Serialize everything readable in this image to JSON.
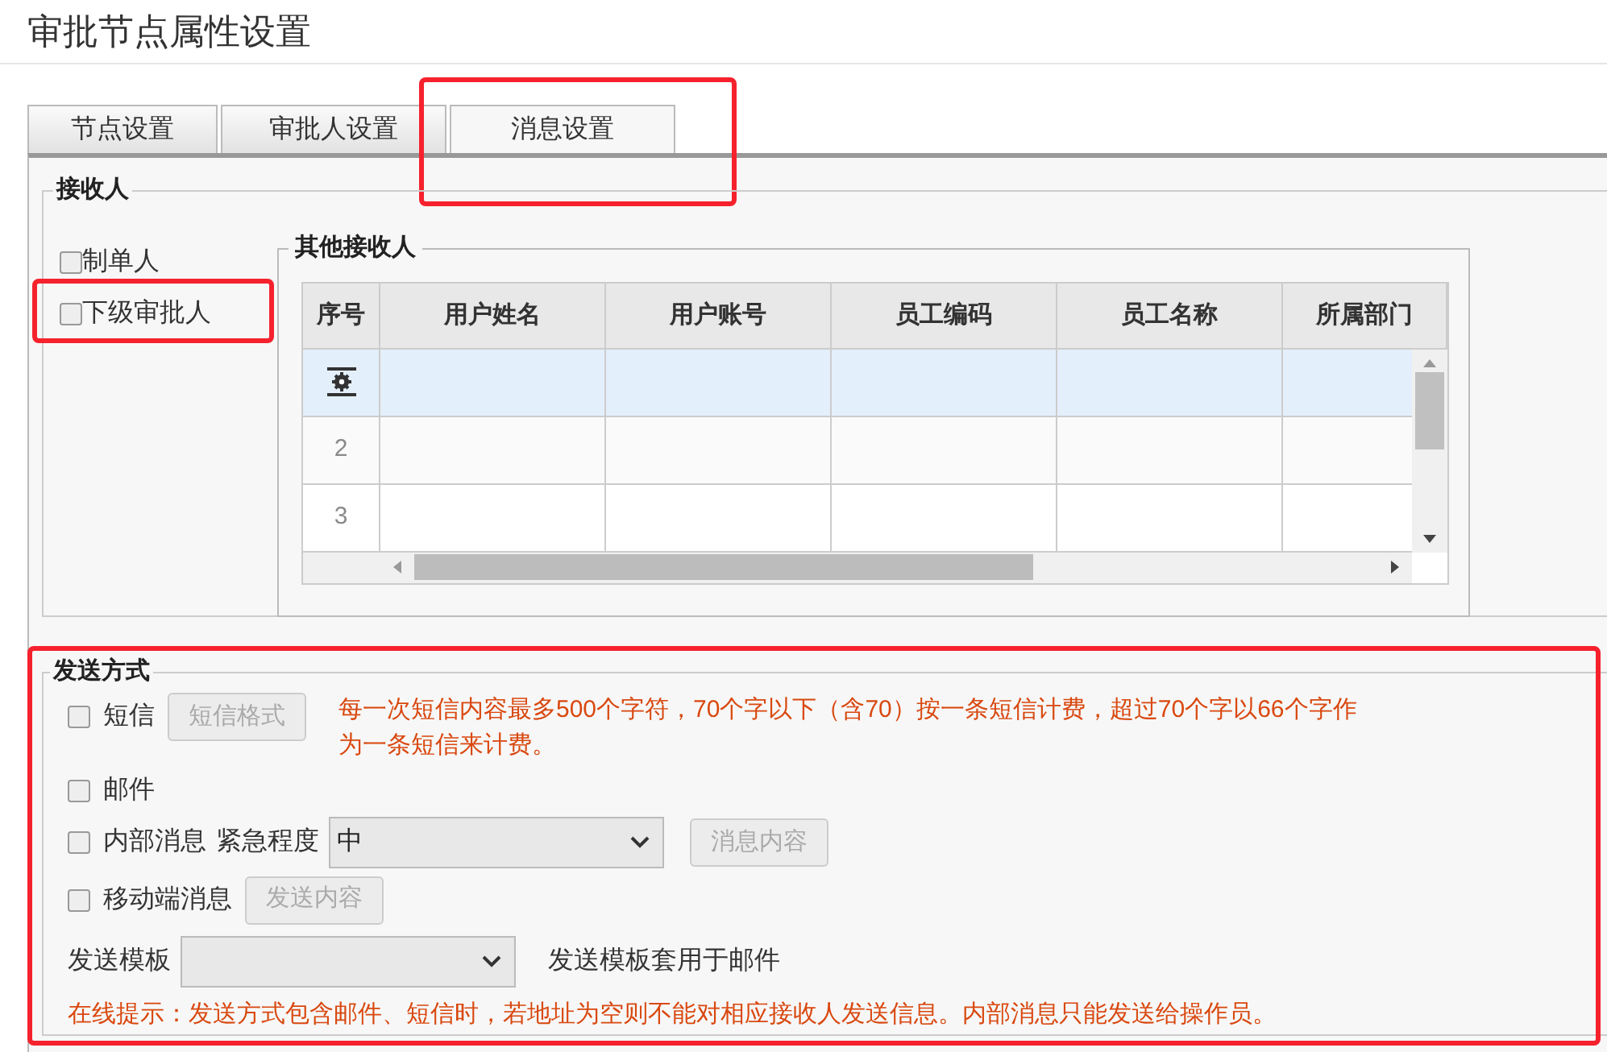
{
  "title": "审批节点属性设置",
  "tabs": [
    {
      "label": "节点设置",
      "selected": false,
      "highlighted": false
    },
    {
      "label": "审批人设置",
      "selected": false,
      "highlighted": false
    },
    {
      "label": "消息设置",
      "selected": true,
      "highlighted": true
    }
  ],
  "receivers": {
    "legend": "接收人",
    "options": [
      {
        "label": "制单人",
        "checked": false,
        "highlighted": false
      },
      {
        "label": "下级审批人",
        "checked": false,
        "highlighted": true
      }
    ],
    "other": {
      "legend": "其他接收人",
      "columns": [
        "序号",
        "用户姓名",
        "用户账号",
        "员工编码",
        "员工名称",
        "所属部门"
      ],
      "rows": [
        {
          "kind": "edit",
          "selected": true
        },
        {
          "kind": "number",
          "number": "2",
          "selected": false
        },
        {
          "kind": "number",
          "number": "3",
          "selected": false
        }
      ]
    }
  },
  "send_methods": {
    "legend": "发送方式",
    "highlighted": true,
    "sms": {
      "label": "短信",
      "checked": false,
      "button": "短信格式",
      "note": "每一次短信内容最多500个字符，70个字以下（含70）按一条短信计费，超过70个字以66个字作为一条短信来计费。"
    },
    "email": {
      "label": "邮件",
      "checked": false
    },
    "internal": {
      "label": "内部消息",
      "checked": false,
      "urgency_label": "紧急程度",
      "urgency_value": "中",
      "button": "消息内容"
    },
    "mobile": {
      "label": "移动端消息",
      "checked": false,
      "button": "发送内容"
    },
    "template": {
      "label": "发送模板",
      "note": "发送模板套用于邮件"
    },
    "tip": "在线提示：发送方式包含邮件、短信时，若地址为空则不能对相应接收人发送信息。内部消息只能发送给操作员。"
  }
}
